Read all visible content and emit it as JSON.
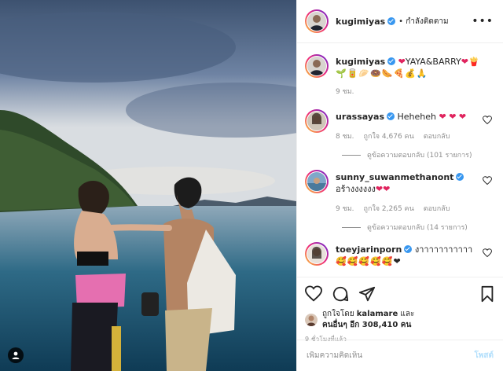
{
  "header": {
    "username": "kugimiyas",
    "follow_state": "• กำลังติดตาม",
    "more_icon": "more-dots-icon"
  },
  "caption": {
    "username": "kugimiyas",
    "text": "YAYA&BARRY",
    "emojis": "🌱🥫🥟🍩🌭🍕💰🙏",
    "time": "9 ชม."
  },
  "comments": [
    {
      "username": "urassayas",
      "text": "Heheheh",
      "hearts": "❤ ❤ ❤",
      "time": "8 ชม.",
      "likes": "ถูกใจ 4,676 คน",
      "reply": "ตอบกลับ",
      "view_replies": "ดูข้อความตอบกลับ (101 รายการ)"
    },
    {
      "username": "sunny_suwanmethanont",
      "text": "อร้างงงงงง",
      "hearts": "❤❤",
      "time": "9 ชม.",
      "likes": "ถูกใจ 2,265 คน",
      "reply": "ตอบกลับ",
      "view_replies": "ดูข้อความตอบกลับ (14 รายการ)"
    },
    {
      "username": "toeyjarinporn",
      "text": "งาาาาาาาาาาา",
      "emojis": "🥰🥰🥰🥰🥰❤"
    }
  ],
  "actions": {
    "liked_by_prefix": "ถูกใจโดย",
    "liked_by_user": "kalamare",
    "liked_by_and": "และ",
    "others_prefix": "คนอื่นๆ อีก",
    "others_count": "308,410",
    "others_suffix": "คน",
    "time_ago": "9 ชั่วโมงที่แล้ว"
  },
  "add_comment": {
    "placeholder": "เพิ่มความคิดเห็น",
    "post_label": "โพสต์"
  },
  "colors": {
    "verified": "#3897f0",
    "heart": "#e0245e",
    "post_button_disabled": "#b2dffc",
    "muted_text": "#8e8e8e"
  }
}
